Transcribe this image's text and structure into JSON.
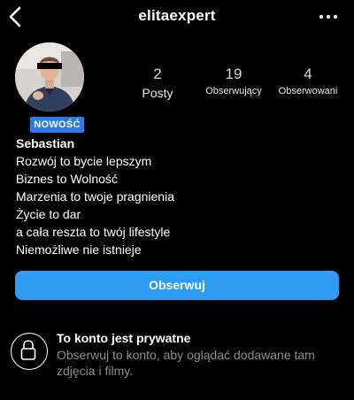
{
  "header": {
    "username": "elitaexpert"
  },
  "profile": {
    "badge": "NOWOŚĆ",
    "name": "Sebastian",
    "bio": [
      "Rozwój to bycie lepszym",
      "Biznes to Wolność",
      "Marzenia to twoje pragnienia",
      "Życie to dar",
      "a cała reszta to twój lifestyle",
      "Niemożliwe nie istnieje"
    ]
  },
  "stats": {
    "posts": {
      "value": "2",
      "label": "Posty"
    },
    "followers": {
      "value": "19",
      "label": "Obserwujący"
    },
    "following": {
      "value": "4",
      "label": "Obserwowani"
    }
  },
  "actions": {
    "follow_label": "Obserwuj"
  },
  "private": {
    "title": "To konto jest prywatne",
    "description": "Obserwuj to konto, aby oglądać dodawane tam zdjęcia i filmy."
  },
  "colors": {
    "accent": "#2e9cf3",
    "badge": "#2c7be5",
    "muted_text": "#8e8e8e"
  }
}
